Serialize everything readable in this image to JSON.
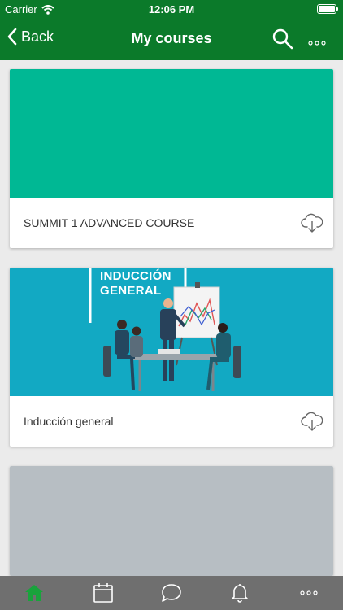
{
  "status": {
    "carrier": "Carrier",
    "time": "12:06 PM"
  },
  "navbar": {
    "back_label": "Back",
    "title": "My courses"
  },
  "courses": [
    {
      "title": "SUMMIT 1 ADVANCED COURSE",
      "image_color": "#00b894"
    },
    {
      "title": "Inducción general",
      "image_color": "#12a9c3",
      "image_heading": [
        "INDUCCIÓN",
        "GENERAL"
      ]
    },
    {
      "title": "",
      "image_color": "#b7bec3"
    }
  ],
  "tabs": [
    {
      "icon": "home-icon",
      "active": true
    },
    {
      "icon": "calendar-icon"
    },
    {
      "icon": "chat-icon"
    },
    {
      "icon": "bell-icon"
    },
    {
      "icon": "more-icon"
    }
  ],
  "colors": {
    "primary": "#0b7a2a",
    "tabbar": "#6f6f6f",
    "active_tab": "#19a33c"
  }
}
